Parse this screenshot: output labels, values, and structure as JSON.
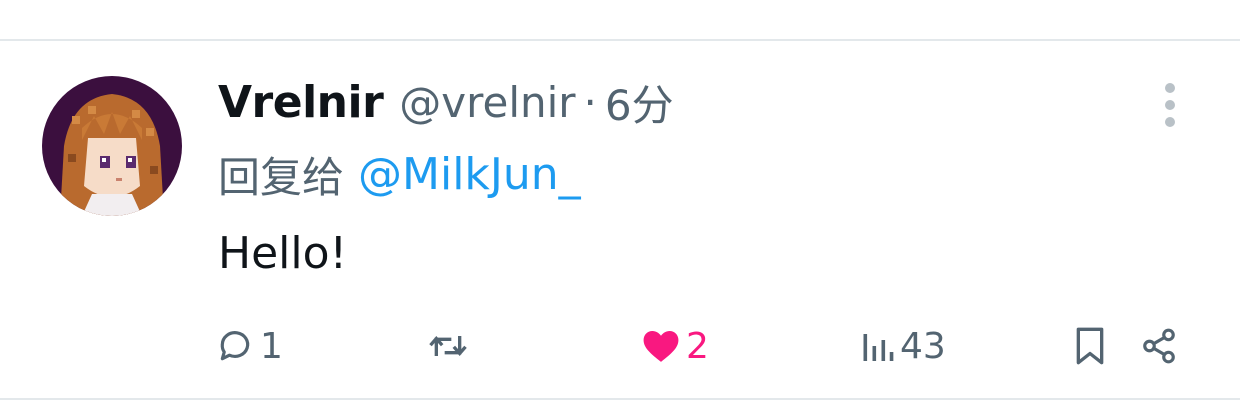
{
  "tweet": {
    "display_name": "Vrelnir",
    "handle": "@vrelnir",
    "separator": "·",
    "time": "6分",
    "reply_prefix": "回复给",
    "reply_mention": "@MilkJun_",
    "text": "Hello!"
  },
  "actions": {
    "reply_count": "1",
    "repost_count": "",
    "like_count": "2",
    "views_count": "43"
  },
  "colors": {
    "text": "#0f1419",
    "secondary": "#536471",
    "link": "#1d9bf0",
    "like": "#f91880",
    "divider": "#e3e8eb"
  },
  "icons": {
    "more": "more-vertical-icon",
    "reply": "reply-bubble-icon",
    "repost": "repost-icon",
    "like": "heart-icon",
    "views": "views-bar-icon",
    "bookmark": "bookmark-icon",
    "share": "share-icon"
  }
}
